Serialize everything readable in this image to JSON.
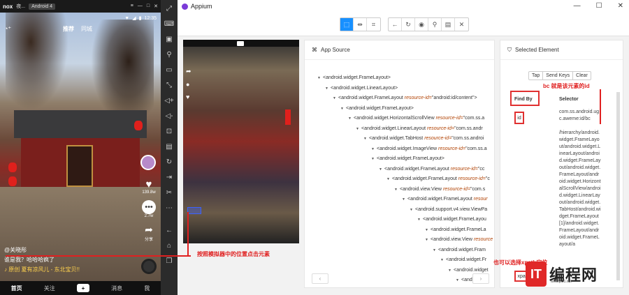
{
  "emulator": {
    "logo": "nox",
    "title": "夜...",
    "android_version": "Android 4",
    "clock": "12:35",
    "feed_tabs": [
      "推荐",
      "同城"
    ],
    "like_count": "139.8w",
    "comment_count": "2.7w",
    "share_label": "分享",
    "author": "@关晓彤",
    "caption_text": "谁是我？哈哈哈疯了",
    "music_text": "♪ 原创 夏有凉风儿 - 东北宝贝!!",
    "bottom_nav": [
      "首页",
      "关注",
      "+",
      "消息",
      "我"
    ]
  },
  "sidebar_icons": [
    "fullscreen-icon",
    "keyboard-icon",
    "screenshot-icon",
    "location-icon",
    "screen-icon",
    "resize-icon",
    "volume-up-icon",
    "volume-down-icon",
    "scan-icon",
    "apk-icon",
    "refresh-icon",
    "import-icon",
    "scissors-icon",
    "more-icon",
    "back-icon",
    "home-icon",
    "recents-icon"
  ],
  "appium": {
    "window_title": "Appium",
    "app_source_title": "App Source",
    "selected_element_title": "Selected Element",
    "actions": [
      "Tap",
      "Send Keys",
      "Clear"
    ],
    "find_by_header": "Find By",
    "selector_header": "Selector",
    "id_label": "id",
    "id_value": "com.ss.android.ugc.aweme:id/bc",
    "xpath_label": "xpath",
    "xpath_value": "/hierarchy/android.widget.FrameLayout/android.widget.LinearLayout/android.widget.FrameLayout/android.widget.FrameLayout/android.widget.HorizontalScrollView/android.widget.LinearLayout/android.widget.TabHost/android.widget.FrameLayout[1]/android.widget.FrameLayout/android.widget.FrameLayout/a",
    "tree_rows": [
      {
        "indent": 0,
        "tag": "<android.widget.FrameLayout>",
        "attr": "",
        "val": ""
      },
      {
        "indent": 1,
        "tag": "<android.widget.LinearLayout>",
        "attr": "",
        "val": ""
      },
      {
        "indent": 2,
        "tag": "<android.widget.FrameLayout ",
        "attr": "resource-id=",
        "val": "\"android:id/content\">"
      },
      {
        "indent": 3,
        "tag": "<android.widget.FrameLayout>",
        "attr": "",
        "val": ""
      },
      {
        "indent": 4,
        "tag": "<android.widget.HorizontalScrollView ",
        "attr": "resource-id=",
        "val": "\"com.ss.a"
      },
      {
        "indent": 5,
        "tag": "<android.widget.LinearLayout ",
        "attr": "resource-id=",
        "val": "\"com.ss.andr"
      },
      {
        "indent": 6,
        "tag": "<android.widget.TabHost ",
        "attr": "resource-id=",
        "val": "\"com.ss.androi"
      },
      {
        "indent": 7,
        "tag": "<android.widget.ImageView ",
        "attr": "resource-id=",
        "val": "\"com.ss.a"
      },
      {
        "indent": 7,
        "tag": "<android.widget.FrameLayout>",
        "attr": "",
        "val": ""
      },
      {
        "indent": 8,
        "tag": "<android.widget.FrameLayout ",
        "attr": "resource-id=",
        "val": "\"cc"
      },
      {
        "indent": 9,
        "tag": "<android.widget.FrameLayout ",
        "attr": "resource-id=",
        "val": "\"c"
      },
      {
        "indent": 10,
        "tag": "<android.view.View ",
        "attr": "resource-id=",
        "val": "\"com.s"
      },
      {
        "indent": 11,
        "tag": "<android.widget.FrameLayout ",
        "attr": "resour",
        "val": ""
      },
      {
        "indent": 12,
        "tag": "<android.support.v4.view.ViewPa",
        "attr": "",
        "val": ""
      },
      {
        "indent": 13,
        "tag": "<android.widget.FrameLayou",
        "attr": "",
        "val": ""
      },
      {
        "indent": 14,
        "tag": "<android.widget.FrameLa",
        "attr": "",
        "val": ""
      },
      {
        "indent": 14,
        "tag": "<android.view.View ",
        "attr": "resource",
        "val": ""
      },
      {
        "indent": 15,
        "tag": "<android.widget.Fram",
        "attr": "",
        "val": ""
      },
      {
        "indent": 16,
        "tag": "<android.widget.Fr",
        "attr": "",
        "val": ""
      },
      {
        "indent": 17,
        "tag": "<android.widget",
        "attr": "",
        "val": ""
      },
      {
        "indent": 18,
        "tag": "<android.wid",
        "attr": "",
        "val": ""
      }
    ]
  },
  "annotations": {
    "bc_note": "bc 就是该元素的id",
    "click_note": "按照模拟器中的位置点击元素",
    "xpath_note": "也可以选择xpath定位"
  },
  "watermark": {
    "badge": "IT",
    "text": "编程网",
    "sub": "www.jb51.net"
  }
}
